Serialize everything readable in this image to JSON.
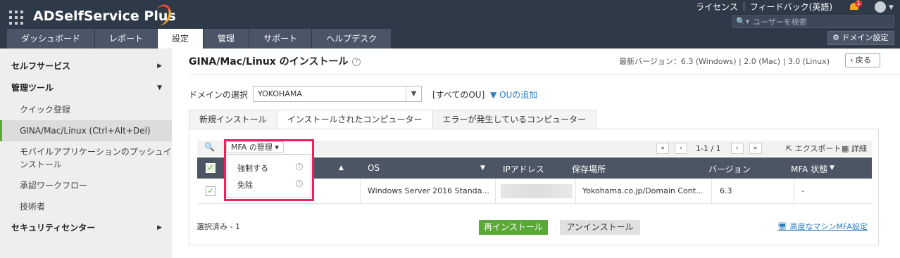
{
  "app": {
    "title": "ADSelfService Plus"
  },
  "header": {
    "links": [
      "ライセンス",
      "フィードバック(英語)"
    ],
    "notification_count": "1",
    "search_placeholder": "ユーザーを検索",
    "domain_settings": "ドメイン設定"
  },
  "tabs": [
    {
      "label": "ダッシュボード",
      "active": false
    },
    {
      "label": "レポート",
      "active": false
    },
    {
      "label": "設定",
      "active": true
    },
    {
      "label": "管理",
      "active": false
    },
    {
      "label": "サポート",
      "active": false
    },
    {
      "label": "ヘルプデスク",
      "active": false
    }
  ],
  "sidebar": {
    "sections": [
      {
        "label": "セルフサービス",
        "expanded": false
      },
      {
        "label": "管理ツール",
        "expanded": true
      },
      {
        "label": "セキュリティセンター",
        "expanded": false
      }
    ],
    "items": [
      {
        "label": "クイック登録"
      },
      {
        "label": "GINA/Mac/Linux (Ctrl+Alt+Del)"
      },
      {
        "label": "モバイルアプリケーションのプッシュインストール"
      },
      {
        "label": "承認ワークフロー"
      },
      {
        "label": "技術者"
      }
    ]
  },
  "page": {
    "title": "GINA/Mac/Linux のインストール",
    "latest_version": "最新バージョン：6.3 (Windows) | 2.0 (Mac) | 3.0 (Linux)",
    "back": "戻る",
    "domain_label": "ドメインの選択",
    "domain_value": "YOKOHAMA",
    "all_ou": "[すべてのOU]",
    "add_ou": "OUの追加"
  },
  "content_tabs": [
    {
      "label": "新規インストール",
      "active": false
    },
    {
      "label": "インストールされたコンピューター",
      "active": true
    },
    {
      "label": "エラーが発生しているコンピューター",
      "active": false
    }
  ],
  "toolbar": {
    "mfa_manage": "MFA の管理",
    "page_info": "1-1 / 1",
    "export": "エクスポート",
    "detail": "詳細"
  },
  "table": {
    "columns": [
      "OS",
      "IPアドレス",
      "保存場所",
      "バージョン",
      "MFA 状態"
    ],
    "rows": [
      {
        "os": "Windows Server 2016 Standa...",
        "ip": "",
        "location": "Yokohama.co.jp/Domain Cont...",
        "version": "6.3",
        "mfa": "-",
        "checked": true
      }
    ]
  },
  "footer": {
    "selected": "選択済み - 1",
    "reinstall": "再インストール",
    "uninstall": "アンインストール",
    "advanced_mfa": "高度なマシンMFA設定"
  },
  "mfa_dropdown": {
    "items": [
      "強制する",
      "免除"
    ]
  },
  "colors": {
    "header_bg": "#2f3a48",
    "accent_green": "#5aa938",
    "highlight_border": "#e8245f",
    "link_blue": "#2a7bbf"
  }
}
